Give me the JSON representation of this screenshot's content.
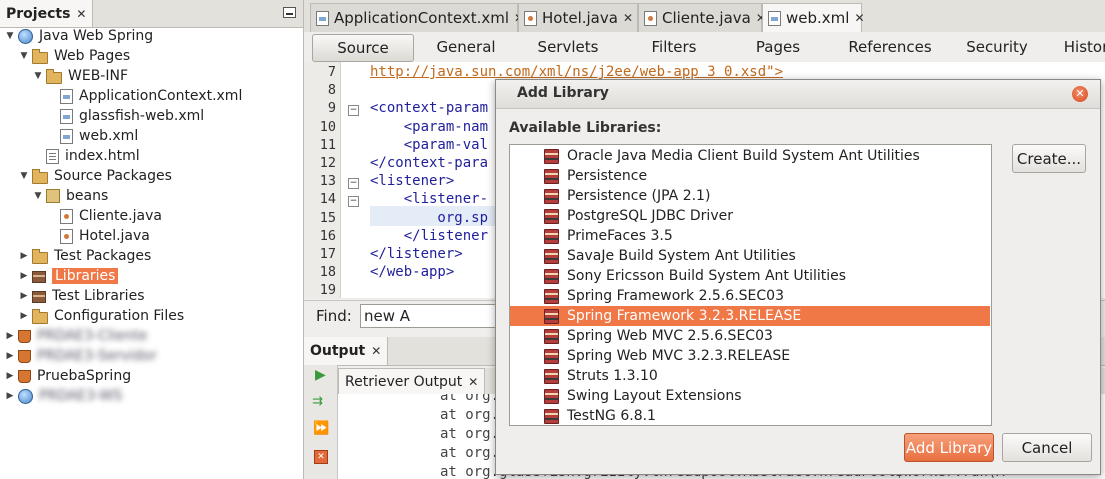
{
  "projects": {
    "tab_label": "Projects",
    "tree": [
      {
        "label": "Java Web Spring",
        "icon": "globe-icon",
        "depth": 0,
        "expanded": true
      },
      {
        "label": "Web Pages",
        "icon": "folder-icon",
        "depth": 1,
        "expanded": true
      },
      {
        "label": "WEB-INF",
        "icon": "folder-icon",
        "depth": 2,
        "expanded": true
      },
      {
        "label": "ApplicationContext.xml",
        "icon": "xml-file-icon",
        "depth": 3
      },
      {
        "label": "glassfish-web.xml",
        "icon": "xml-file-icon",
        "depth": 3
      },
      {
        "label": "web.xml",
        "icon": "xml-file-icon",
        "depth": 3
      },
      {
        "label": "index.html",
        "icon": "html-file-icon",
        "depth": 2
      },
      {
        "label": "Source Packages",
        "icon": "folder-icon",
        "depth": 1,
        "expanded": true
      },
      {
        "label": "beans",
        "icon": "package-icon",
        "depth": 2,
        "expanded": true
      },
      {
        "label": "Cliente.java",
        "icon": "java-file-icon",
        "depth": 3
      },
      {
        "label": "Hotel.java",
        "icon": "java-file-icon",
        "depth": 3
      },
      {
        "label": "Test Packages",
        "icon": "folder-icon",
        "depth": 1,
        "expanded": false
      },
      {
        "label": "Libraries",
        "icon": "libraries-icon",
        "depth": 1,
        "expanded": false,
        "selected": true
      },
      {
        "label": "Test Libraries",
        "icon": "libraries-icon",
        "depth": 1,
        "expanded": false
      },
      {
        "label": "Configuration Files",
        "icon": "folder-icon",
        "depth": 1,
        "expanded": false
      },
      {
        "label": "PRDAE3-Cliente",
        "icon": "cup-icon",
        "depth": 0,
        "expanded": false,
        "blurred": true
      },
      {
        "label": "PRDAE3-Servidor",
        "icon": "cup-icon",
        "depth": 0,
        "expanded": false,
        "blurred": true
      },
      {
        "label": "PruebaSpring",
        "icon": "cup-icon",
        "depth": 0,
        "expanded": false
      },
      {
        "label": "PRDAE3-WS",
        "icon": "globe-icon",
        "depth": 0,
        "expanded": false,
        "blurred": true
      }
    ]
  },
  "editor": {
    "tabs": [
      {
        "label": "ApplicationContext.xml",
        "icon": "xml-file-icon",
        "active": false
      },
      {
        "label": "Hotel.java",
        "icon": "java-file-icon",
        "active": false
      },
      {
        "label": "Cliente.java",
        "icon": "java-file-icon",
        "active": false
      },
      {
        "label": "web.xml",
        "icon": "xml-file-icon",
        "active": true
      }
    ],
    "subtabs": [
      "Source",
      "General",
      "Servlets",
      "Filters",
      "Pages",
      "References",
      "Security",
      "Histor"
    ],
    "active_subtab": "Source",
    "line_numbers": [
      "7",
      "8",
      "9",
      "10",
      "11",
      "12",
      "13",
      "14",
      "15",
      "16",
      "17",
      "18",
      "19"
    ],
    "code_lines": [
      "http://java.sun.com/xml/ns/j2ee/web-app_3_0.xsd\">",
      "",
      "<context-param",
      "    <param-nam",
      "    <param-val",
      "</context-para",
      "<listener>",
      "    <listener-",
      "        org.sp",
      "    </listener",
      "</listener>",
      "</web-app>",
      ""
    ],
    "find_label": "Find:",
    "find_value": "new A"
  },
  "output": {
    "tab_label": "Output",
    "sub_tab_label": "Retriever Output",
    "lines": [
      "at org.",
      "at org.",
      "at org.",
      "at org.",
      "at org.glassfish.grizzly.threadpool.AbstractThreadPool$Worker.run(A"
    ]
  },
  "dialog": {
    "title": "Add Library",
    "list_label": "Available Libraries:",
    "libraries": [
      "Oracle Java Media Client Build System Ant Utilities",
      "Persistence",
      "Persistence (JPA 2.1)",
      "PostgreSQL JDBC Driver",
      "PrimeFaces 3.5",
      "SavaJe Build System Ant Utilities",
      "Sony Ericsson Build System Ant Utilities",
      "Spring Framework 2.5.6.SEC03",
      "Spring Framework 3.2.3.RELEASE",
      "Spring Web MVC 2.5.6.SEC03",
      "Spring Web MVC 3.2.3.RELEASE",
      "Struts 1.3.10",
      "Swing Layout Extensions",
      "TestNG 6.8.1"
    ],
    "selected_library": "Spring Framework 3.2.3.RELEASE",
    "create_label": "Create...",
    "add_label": "Add Library",
    "cancel_label": "Cancel"
  },
  "colors": {
    "selection": "#f07746",
    "xml_tag": "#1f1f9c",
    "url": "#c46a1a"
  }
}
